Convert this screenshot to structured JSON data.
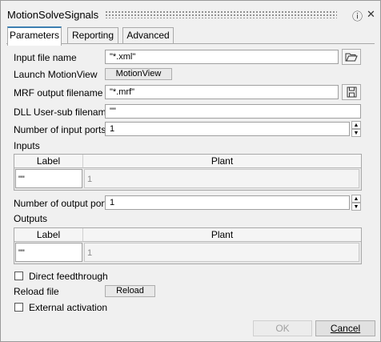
{
  "window": {
    "title": "MotionSolveSignals",
    "help_icon": "help-icon",
    "close_icon": "close-icon"
  },
  "tabs": [
    {
      "label": "Parameters",
      "active": true
    },
    {
      "label": "Reporting",
      "active": false
    },
    {
      "label": "Advanced",
      "active": false
    }
  ],
  "params": {
    "input_file_label": "Input file name",
    "input_file_value": "\"*.xml\"",
    "launch_label": "Launch MotionView",
    "launch_button": "MotionView",
    "mrf_label": "MRF output filename",
    "mrf_value": "\"*.mrf\"",
    "dll_label": "DLL User-sub filename",
    "dll_value": "\"\"",
    "num_inputs_label": "Number of input ports",
    "num_inputs_value": "1",
    "inputs_section": "Inputs",
    "inputs_table": {
      "headers": [
        "Label",
        "Plant"
      ],
      "rows": [
        {
          "label": "\"\"",
          "plant": "1"
        }
      ]
    },
    "num_outputs_label": "Number of output ports",
    "num_outputs_value": "1",
    "outputs_section": "Outputs",
    "outputs_table": {
      "headers": [
        "Label",
        "Plant"
      ],
      "rows": [
        {
          "label": "\"\"",
          "plant": "1"
        }
      ]
    },
    "direct_feedthrough_label": "Direct feedthrough",
    "direct_feedthrough_checked": false,
    "reload_label": "Reload file",
    "reload_button": "Reload",
    "external_activation_label": "External activation",
    "external_activation_checked": false
  },
  "footer": {
    "ok_label": "OK",
    "ok_enabled": false,
    "cancel_label": "Cancel"
  }
}
